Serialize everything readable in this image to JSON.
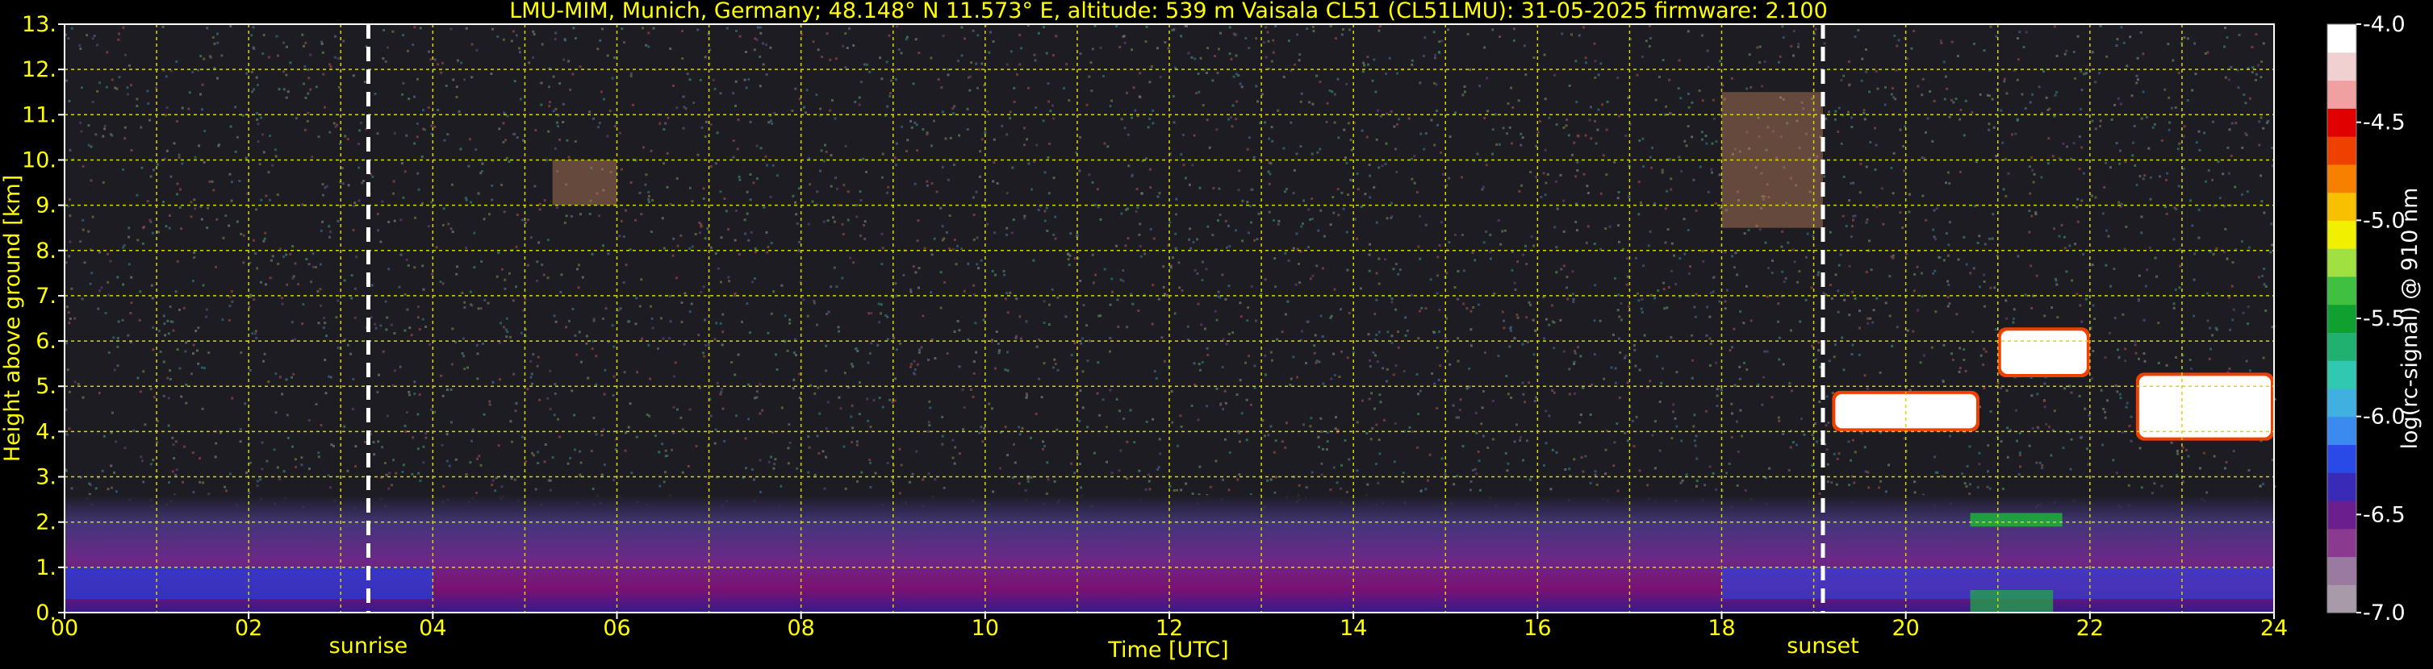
{
  "chart_data": {
    "type": "heatmap",
    "title": "LMU-MIM, Munich, Germany; 48.148° N 11.573° E, altitude: 539 m    Vaisala CL51 (CL51LMU): 31-05-2025    firmware: 2.100",
    "xlabel": "Time [UTC]",
    "ylabel": "Height above ground [km]",
    "xlim": [
      0,
      24
    ],
    "ylim": [
      0,
      13
    ],
    "x_ticks": [
      "00",
      "02",
      "04",
      "06",
      "08",
      "10",
      "12",
      "14",
      "16",
      "18",
      "20",
      "22",
      "24"
    ],
    "y_ticks": [
      "0.",
      "1.",
      "2.",
      "3.",
      "4.",
      "5.",
      "6.",
      "7.",
      "8.",
      "9.",
      "10.",
      "11.",
      "12.",
      "13."
    ],
    "grid": true,
    "markers": [
      {
        "label": "sunrise",
        "x": 3.3
      },
      {
        "label": "sunset",
        "x": 19.1
      }
    ],
    "colorbar": {
      "label": "log(rc-signal) @ 910 nm",
      "range": [
        -7.0,
        -4.0
      ],
      "ticks": [
        "-4.0",
        "-4.5",
        "-5.0",
        "-5.5",
        "-6.0",
        "-6.5",
        "-7.0"
      ],
      "colors": [
        "#a89aa9",
        "#9a7aa0",
        "#8a3a8f",
        "#6b1f8f",
        "#3a2ab8",
        "#2a4ae8",
        "#3a8af0",
        "#40b0e0",
        "#30c8b0",
        "#20b070",
        "#10a030",
        "#40c040",
        "#a0e040",
        "#f0f000",
        "#f8c000",
        "#f88000",
        "#f04000",
        "#e00000",
        "#f0a0a0",
        "#f0d0d0",
        "#ffffff"
      ]
    },
    "features": [
      {
        "name": "boundary layer aerosol",
        "x": [
          0,
          24
        ],
        "y": [
          0,
          1.0
        ]
      },
      {
        "name": "cloud layer",
        "x": [
          19.2,
          20.8
        ],
        "y": [
          4.0,
          4.9
        ]
      },
      {
        "name": "cloud layer",
        "x": [
          21.0,
          22.0
        ],
        "y": [
          5.2,
          6.3
        ]
      },
      {
        "name": "cloud layer",
        "x": [
          22.5,
          24
        ],
        "y": [
          3.8,
          5.3
        ]
      },
      {
        "name": "high cirrus",
        "x": [
          18.0,
          19.1
        ],
        "y": [
          8.5,
          11.5
        ]
      },
      {
        "name": "high cirrus",
        "x": [
          5.3,
          6.0
        ],
        "y": [
          9.0,
          10.0
        ]
      }
    ]
  }
}
